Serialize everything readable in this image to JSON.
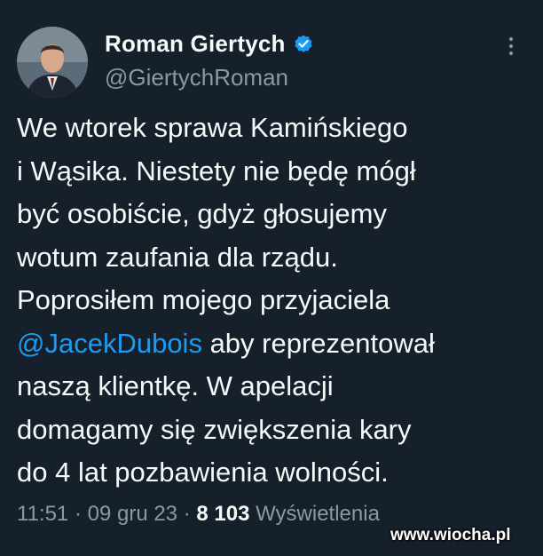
{
  "author": {
    "name": "Roman Giertych",
    "handle": "@GiertychRoman",
    "verified_icon": "verified-badge-icon",
    "verified_color": "#1d9bf0"
  },
  "tweet": {
    "line1": "We wtorek sprawa Kamińskiego",
    "line2": "i Wąsika. Niestety nie będę mógł",
    "line3": "być osobiście, gdyż głosujemy",
    "line4": "wotum zaufania dla rządu.",
    "line5": "Poprosiłem mojego przyjaciela",
    "mention": "@JacekDubois",
    "line6_rest": " aby reprezentował",
    "line7": "naszą klientkę. W apelacji",
    "line8": "domagamy się zwiększenia kary",
    "line9": "do 4 lat pozbawienia wolności."
  },
  "meta": {
    "time": "11:51",
    "sep1": " · ",
    "date": "09 gru 23",
    "sep2": " · ",
    "views_count": "8 103",
    "views_label": " Wyświetlenia"
  },
  "watermark": "www.wiocha.pl",
  "colors": {
    "background": "#15202b",
    "text": "#f7f9f9",
    "secondary": "#8b98a5",
    "link": "#1d9bf0"
  }
}
